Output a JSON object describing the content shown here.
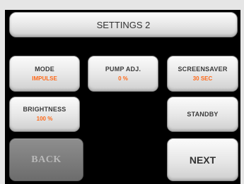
{
  "screen": {
    "title": "SETTINGS 2"
  },
  "settings": {
    "mode": {
      "label": "MODE",
      "value": "IMPULSE"
    },
    "pump_adj": {
      "label": "PUMP ADJ.",
      "value": "0 %"
    },
    "screensaver": {
      "label": "SCREENSAVER",
      "value": "30 SEC"
    },
    "brightness": {
      "label": "BRIGHTNESS",
      "value": "100 %"
    },
    "standby": {
      "label": "STANDBY"
    }
  },
  "nav": {
    "back_label": "BACK",
    "next_label": "NEXT"
  },
  "colors": {
    "value_accent": "#ff6a1a",
    "disabled_button": "#7a7a7a",
    "background": "#000000"
  }
}
